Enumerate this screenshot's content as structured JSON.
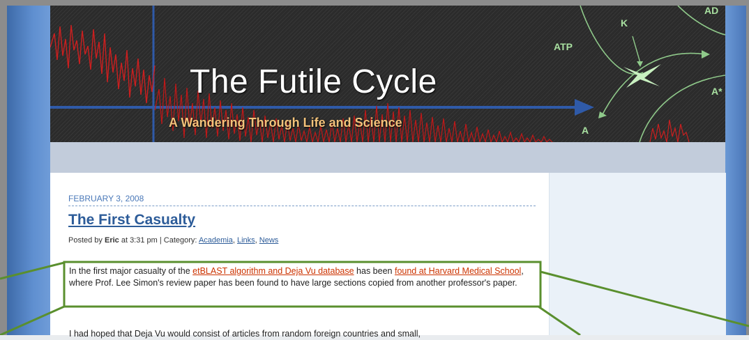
{
  "header": {
    "title": "The Futile Cycle",
    "subtitle": "A Wandering Through Life and Science",
    "diagram_labels": [
      "ATP",
      "K",
      "AD",
      "A*",
      "A"
    ]
  },
  "post": {
    "date": "FEBRUARY 3, 2008",
    "title": "The First Casualty",
    "meta": {
      "posted_by_prefix": "Posted by ",
      "author": "Eric",
      "time_text": " at 3:31 pm | Category: ",
      "categories": [
        "Academia",
        "Links",
        "News"
      ],
      "sep": ", "
    },
    "paragraph1": {
      "t1": "In the first major casualty of the ",
      "link1": "etBLAST algorithm and Deja Vu database",
      "t2": " has been ",
      "link2": "found at Harvard Medical School",
      "t3": ", where Prof. Lee Simon's review paper has been found to have large sections copied from another professor's paper."
    },
    "paragraph2": "I had hoped that Deja Vu would consist of articles from random foreign countries and small,"
  },
  "colors": {
    "highlight_box": "#5a8f2e",
    "link": "#cc3300",
    "title": "#2d5c99",
    "subtitle": "#f2c27a"
  }
}
